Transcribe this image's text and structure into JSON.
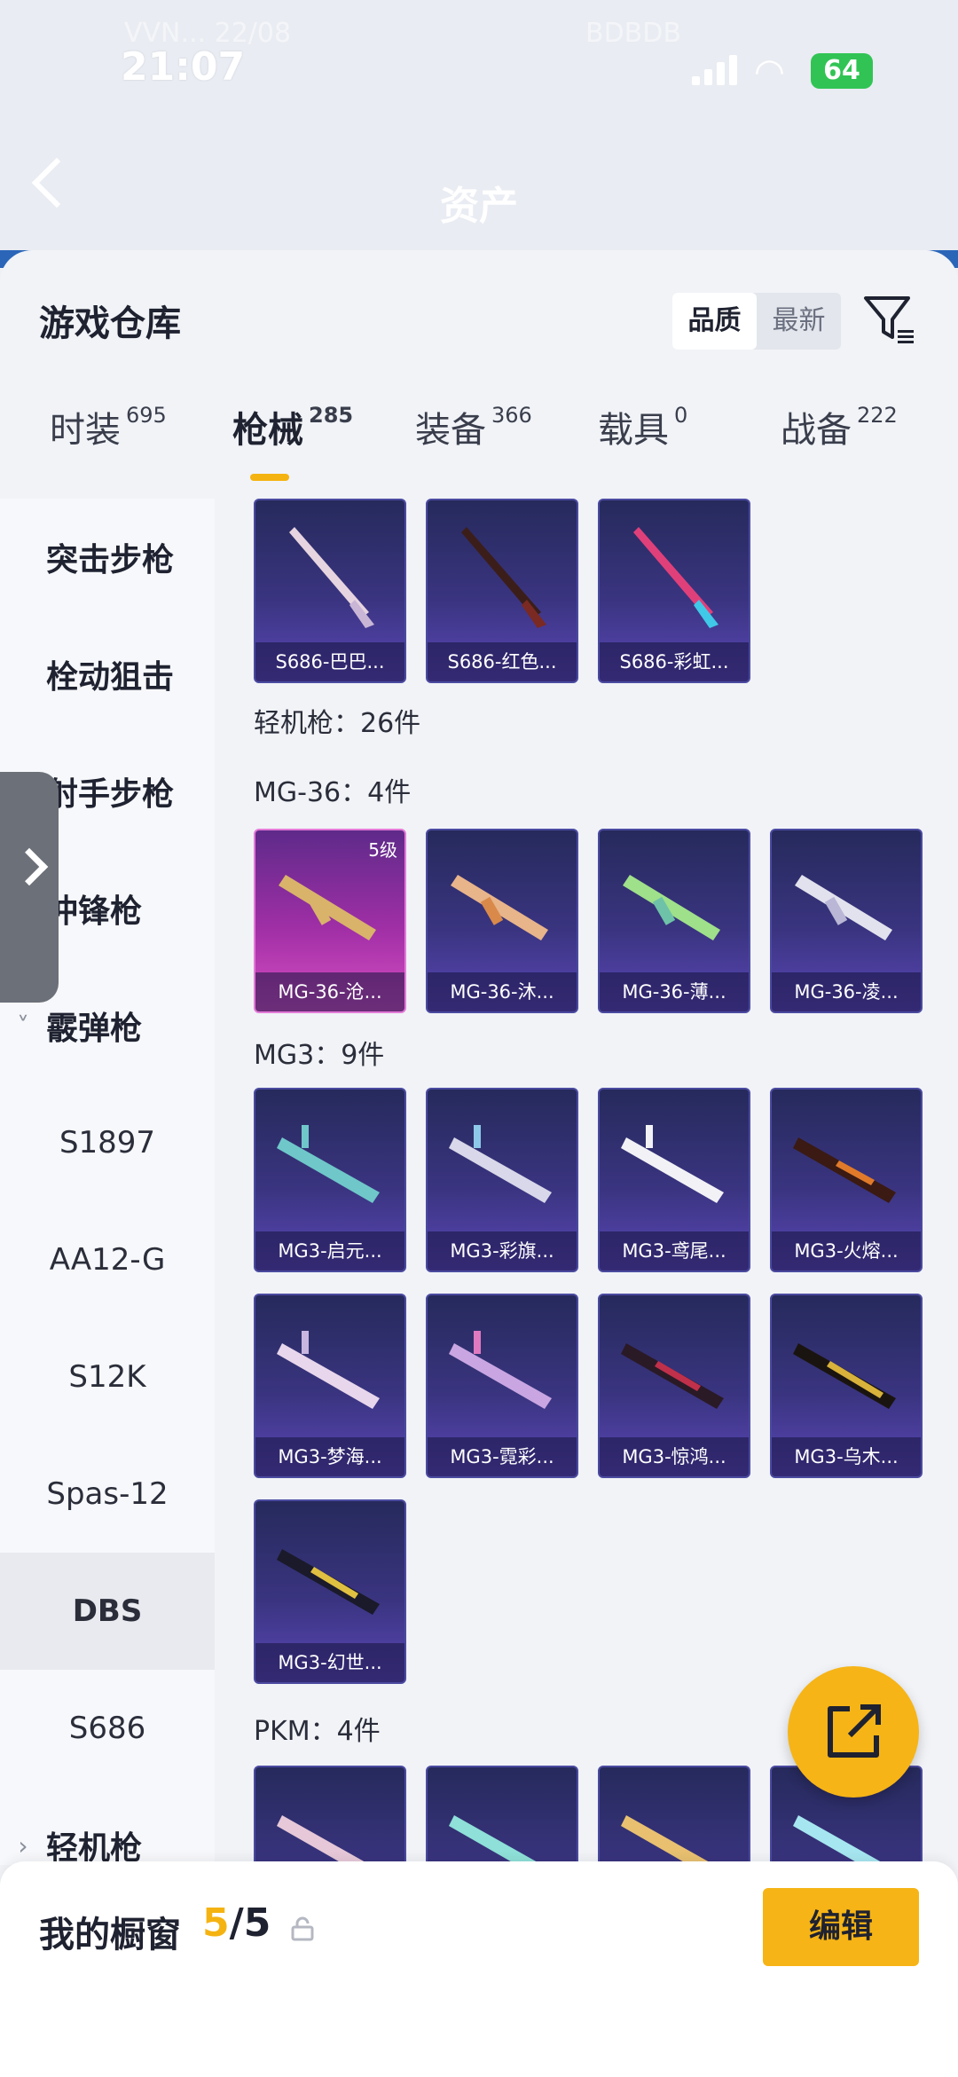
{
  "status_bar": {
    "time": "21:07",
    "battery": "64",
    "ghost_left": "VVN... 22/08",
    "ghost_right": "BDBDB"
  },
  "header": {
    "title": "资产"
  },
  "sheet": {
    "title": "游戏仓库",
    "sort": [
      "品质",
      "最新"
    ],
    "tabs": [
      {
        "label": "时装",
        "count": "695"
      },
      {
        "label": "枪械",
        "count": "285"
      },
      {
        "label": "装备",
        "count": "366"
      },
      {
        "label": "载具",
        "count": "0"
      },
      {
        "label": "战备",
        "count": "222"
      }
    ]
  },
  "categories": [
    {
      "label": "突击步枪",
      "chevron": ""
    },
    {
      "label": "栓动狙击",
      "chevron": ""
    },
    {
      "label": "射手步枪",
      "chevron": "›"
    },
    {
      "label": "冲锋枪",
      "chevron": "›"
    },
    {
      "label": "霰弹枪",
      "chevron": "˅"
    },
    {
      "label": "S1897"
    },
    {
      "label": "AA12-G"
    },
    {
      "label": "S12K"
    },
    {
      "label": "Spas-12"
    },
    {
      "label": "DBS"
    },
    {
      "label": "S686"
    },
    {
      "label": "轻机枪",
      "chevron": "›"
    }
  ],
  "sections": {
    "lmg_total": "轻机枪：26件",
    "mg36": "MG-36：4件",
    "mg3": "MG3：9件",
    "pkm": "PKM：4件"
  },
  "cards": {
    "s686": [
      "S686-巴巴...",
      "S686-红色...",
      "S686-彩虹..."
    ],
    "mg36": [
      "MG-36-沧...",
      "MG-36-沐...",
      "MG-36-薄...",
      "MG-36-凌..."
    ],
    "mg36_level": "5级",
    "mg3": [
      "MG3-启元...",
      "MG3-彩旗...",
      "MG3-鸢尾...",
      "MG3-火熔...",
      "MG3-梦海...",
      "MG3-霓彩...",
      "MG3-惊鸿...",
      "MG3-乌木...",
      "MG3-幻世..."
    ]
  },
  "bottom": {
    "label": "我的橱窗",
    "current": "5",
    "total": "/5",
    "edit": "编辑"
  },
  "colors": {
    "accent": "#f6b416",
    "card_bg": "#3a3480",
    "card_highlight": "#a12fa6"
  }
}
